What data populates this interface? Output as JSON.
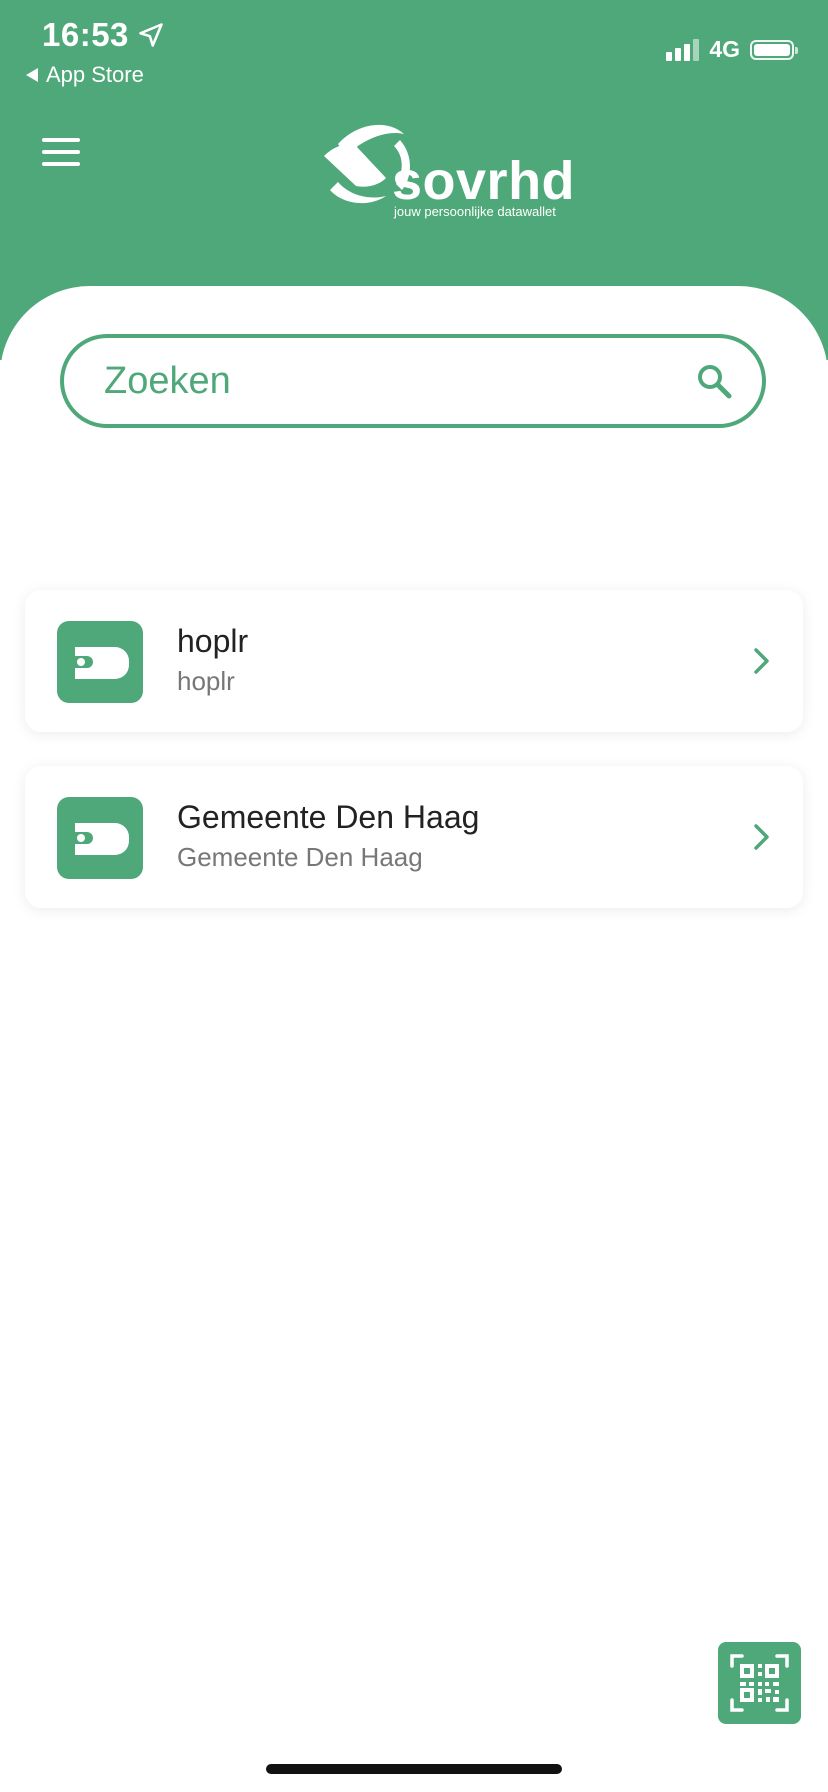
{
  "status_bar": {
    "time": "16:53",
    "back_label": "App Store",
    "network": "4G"
  },
  "header": {
    "logo_text": "sovrhd",
    "logo_tagline": "jouw persoonlijke datawallet",
    "menu_icon": "hamburger-menu-icon"
  },
  "search": {
    "placeholder": "Zoeken"
  },
  "list": [
    {
      "title": "hoplr",
      "subtitle": "hoplr"
    },
    {
      "title": "Gemeente Den Haag",
      "subtitle": "Gemeente Den Haag"
    }
  ],
  "colors": {
    "brand": "#4fa879",
    "background": "#ffffff"
  }
}
